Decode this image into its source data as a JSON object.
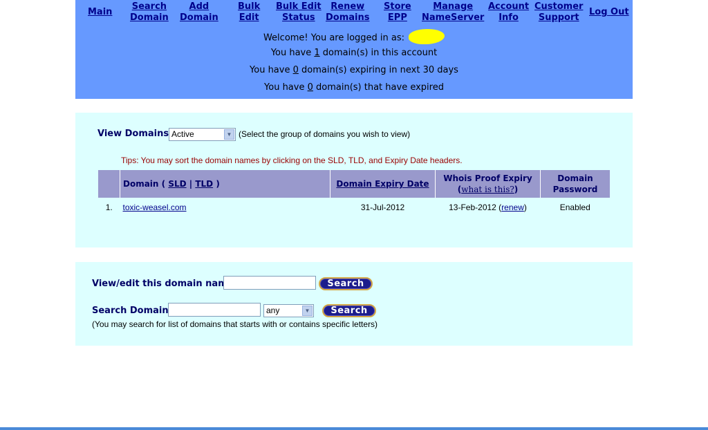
{
  "nav": [
    {
      "line1": "Main",
      "line2": ""
    },
    {
      "line1": "Search",
      "line2": "Domain"
    },
    {
      "line1": "Add",
      "line2": "Domain"
    },
    {
      "line1": "Bulk",
      "line2": "Edit"
    },
    {
      "line1": "Bulk Edit",
      "line2": "Status"
    },
    {
      "line1": "Renew",
      "line2": "Domains"
    },
    {
      "line1": "Store",
      "line2": "EPP"
    },
    {
      "line1": "Manage",
      "line2": "NameServer"
    },
    {
      "line1": "Account",
      "line2": "Info"
    },
    {
      "line1": "Customer",
      "line2": "Support"
    },
    {
      "line1": "Log Out",
      "line2": ""
    }
  ],
  "welcome": {
    "logged_in": "Welcome! You are logged in as:",
    "domains_prefix": "You have ",
    "domains_count": "1",
    "domains_suffix": " domain(s) in this account",
    "expiring_prefix": "You have ",
    "expiring_count": "0",
    "expiring_suffix": " domain(s) expiring in next 30 days",
    "expired_prefix": "You have ",
    "expired_count": "0",
    "expired_suffix": " domain(s) that have expired"
  },
  "view_domains": {
    "label": "View Domains :",
    "selected": "Active",
    "hint": "(Select the group of domains you wish to view)"
  },
  "tips": "Tips: You may sort the domain names by clicking on the SLD, TLD, and Expiry Date headers.",
  "table": {
    "col_domain_prefix": "Domain (",
    "col_sld": "SLD",
    "col_sep": "|",
    "col_tld": "TLD",
    "col_domain_suffix": ")",
    "col_expiry": "Domain Expiry Date",
    "col_whois_line1": "Whois Proof Expiry",
    "col_whois_link": "what is this?",
    "col_password_line1": "Domain",
    "col_password_line2": "Password",
    "rows": [
      {
        "num": "1.",
        "domain": "toxic-weasel.com",
        "expiry": "31-Jul-2012",
        "whois_date": "13-Feb-2012",
        "renew": "renew",
        "password": "Enabled"
      }
    ]
  },
  "search": {
    "view_edit_label": "View/edit this domain name :",
    "search_domain_label": "Search Domain :",
    "match_selected": "any",
    "button_label": "Search",
    "note": "(You may search for list of domains that starts with or contains specific letters)"
  },
  "colors": {
    "header_bg": "#6699ff",
    "panel_bg": "#ddffff",
    "table_header_bg": "#9999cc",
    "link": "#00008b"
  }
}
